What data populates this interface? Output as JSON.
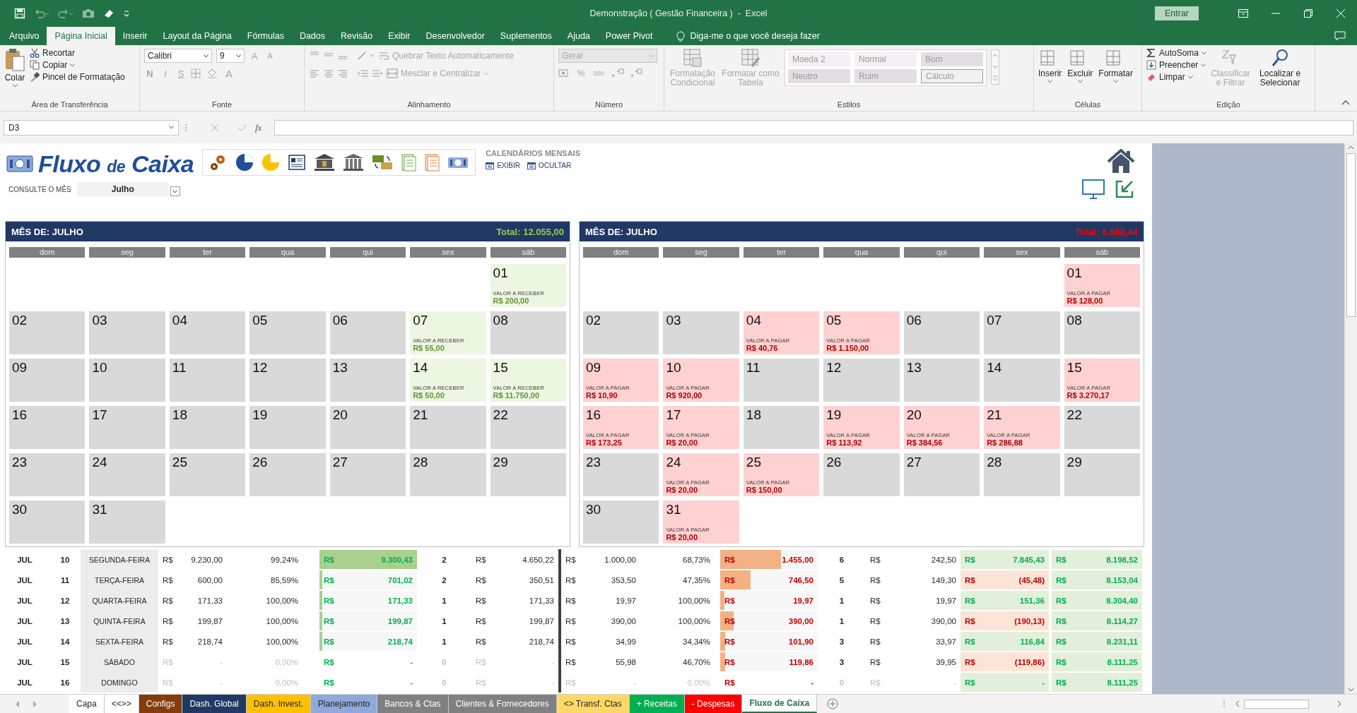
{
  "window": {
    "title": "Demonstração ( Gestão Financeira )  -  Excel",
    "sign_in": "Entrar"
  },
  "menu_tabs": [
    {
      "label": "Arquivo",
      "selected": false
    },
    {
      "label": "Página Inicial",
      "selected": true
    },
    {
      "label": "Inserir",
      "selected": false
    },
    {
      "label": "Layout da Página",
      "selected": false
    },
    {
      "label": "Fórmulas",
      "selected": false
    },
    {
      "label": "Dados",
      "selected": false
    },
    {
      "label": "Revisão",
      "selected": false
    },
    {
      "label": "Exibir",
      "selected": false
    },
    {
      "label": "Desenvolvedor",
      "selected": false
    },
    {
      "label": "Suplementos",
      "selected": false
    },
    {
      "label": "Ajuda",
      "selected": false
    },
    {
      "label": "Power Pivot",
      "selected": false
    }
  ],
  "tell_me": "Diga-me o que você deseja fazer",
  "ribbon": {
    "clipboard": {
      "title": "Área de Transferência",
      "paste": "Colar",
      "cut": "Recortar",
      "copy": "Copiar",
      "painter": "Pincel de Formatação"
    },
    "font": {
      "title": "Fonte",
      "font_name": "Calibri",
      "font_size": "9",
      "grow": "A",
      "shrink": "A",
      "format_buttons": [
        "N",
        "I",
        "S"
      ],
      "font_color": "A"
    },
    "alignment": {
      "title": "Alinhamento",
      "wrap": {
        "label": "Quebrar Texto Automaticamente",
        "disabled": true
      },
      "merge": {
        "label": "Mesclar e Centralizar",
        "disabled": true
      }
    },
    "number": {
      "title": "Número",
      "format": {
        "value": "Geral",
        "disabled": true
      },
      "percent": "%",
      "thousands": "000"
    },
    "styles": {
      "title": "Estilos",
      "conditional": {
        "label": "Formatação Condicional",
        "disabled": true
      },
      "as_table": {
        "label": "Formatar como Tabela",
        "disabled": true
      },
      "gallery": [
        {
          "label": "Moeda 2",
          "kind": "plain"
        },
        {
          "label": "Normal",
          "kind": "plain"
        },
        {
          "label": "Bom",
          "kind": "filled"
        },
        {
          "label": "Neutro",
          "kind": "filled"
        },
        {
          "label": "Ruim",
          "kind": "filled"
        },
        {
          "label": "Cálculo",
          "kind": "outlined"
        }
      ]
    },
    "cells": {
      "title": "Células",
      "items": [
        "Inserir",
        "Excluir",
        "Formatar"
      ]
    },
    "editing": {
      "title": "Edição",
      "autosum": "AutoSoma",
      "fill": "Preencher",
      "clear": "Limpar",
      "sort": {
        "label": "Classificar e Filtrar",
        "disabled": true
      },
      "find": "Localizar e Selecionar"
    }
  },
  "formula_bar": {
    "name_box": "D3",
    "fx": "fx"
  },
  "sheet": {
    "title_parts": [
      "Fluxo",
      "de",
      "Caixa"
    ],
    "calendars_label": "CALENDÁRIOS MENSAIS",
    "show": "EXIBIR",
    "hide": "OCULTAR",
    "month_prompt": "CONSULTE O MÊS",
    "month": "Julho"
  },
  "calendars": [
    {
      "title": "MÊS DE: JULHO",
      "total": "Total: 12.055,00",
      "color": "#92d050",
      "weekdays": [
        "dom",
        "seg",
        "ter",
        "qua",
        "qui",
        "sex",
        "sáb"
      ],
      "weeks": [
        [
          {
            "day": "01",
            "label": "VALOR A RECEBER",
            "amount": "R$ 200,00"
          }
        ],
        [
          {
            "day": "02"
          },
          {
            "day": "03"
          },
          {
            "day": "04"
          },
          {
            "day": "05"
          },
          {
            "day": "06"
          },
          {
            "day": "07",
            "label": "VALOR A RECEBER",
            "amount": "R$ 55,00"
          },
          {
            "day": "08"
          }
        ],
        [
          {
            "day": "09"
          },
          {
            "day": "10"
          },
          {
            "day": "11"
          },
          {
            "day": "12"
          },
          {
            "day": "13"
          },
          {
            "day": "14",
            "label": "VALOR A RECEBER",
            "amount": "R$ 50,00"
          },
          {
            "day": "15",
            "label": "VALOR A RECEBER",
            "amount": "R$ 11.750,00"
          }
        ],
        [
          {
            "day": "16"
          },
          {
            "day": "17"
          },
          {
            "day": "18"
          },
          {
            "day": "19"
          },
          {
            "day": "20"
          },
          {
            "day": "21"
          },
          {
            "day": "22"
          }
        ],
        [
          {
            "day": "23"
          },
          {
            "day": "24"
          },
          {
            "day": "25"
          },
          {
            "day": "26"
          },
          {
            "day": "27"
          },
          {
            "day": "28"
          },
          {
            "day": "29"
          }
        ],
        [
          {
            "day": "30"
          },
          {
            "day": "31"
          }
        ]
      ]
    },
    {
      "title": "MÊS DE: JULHO",
      "total": "Total: 6.688,44",
      "color": "#ff0000",
      "weekdays": [
        "dom",
        "seg",
        "ter",
        "qua",
        "qui",
        "sex",
        "sáb"
      ],
      "weeks": [
        [
          {
            "day": "01",
            "label": "VALOR A PAGAR",
            "amount": "R$ 128,00"
          }
        ],
        [
          {
            "day": "02"
          },
          {
            "day": "03"
          },
          {
            "day": "04",
            "label": "VALOR A PAGAR",
            "amount": "R$ 40,76"
          },
          {
            "day": "05",
            "label": "VALOR A PAGAR",
            "amount": "R$ 1.150,00"
          },
          {
            "day": "06"
          },
          {
            "day": "07"
          },
          {
            "day": "08"
          }
        ],
        [
          {
            "day": "09",
            "label": "VALOR A PAGAR",
            "amount": "R$ 10,90"
          },
          {
            "day": "10",
            "label": "VALOR A PAGAR",
            "amount": "R$ 920,00"
          },
          {
            "day": "11"
          },
          {
            "day": "12"
          },
          {
            "day": "13"
          },
          {
            "day": "14"
          },
          {
            "day": "15",
            "label": "VALOR A PAGAR",
            "amount": "R$ 3.270,17"
          }
        ],
        [
          {
            "day": "16",
            "label": "VALOR A PAGAR",
            "amount": "R$ 173,25"
          },
          {
            "day": "17",
            "label": "VALOR A PAGAR",
            "amount": "R$ 20,00"
          },
          {
            "day": "18"
          },
          {
            "day": "19",
            "label": "VALOR A PAGAR",
            "amount": "R$ 113,92"
          },
          {
            "day": "20",
            "label": "VALOR A PAGAR",
            "amount": "R$ 384,56"
          },
          {
            "day": "21",
            "label": "VALOR A PAGAR",
            "amount": "R$ 286,88"
          },
          {
            "day": "22"
          }
        ],
        [
          {
            "day": "23"
          },
          {
            "day": "24",
            "label": "VALOR A PAGAR",
            "amount": "R$ 20,00"
          },
          {
            "day": "25",
            "label": "VALOR A PAGAR",
            "amount": "R$ 150,00"
          },
          {
            "day": "26"
          },
          {
            "day": "27"
          },
          {
            "day": "28"
          },
          {
            "day": "29"
          }
        ],
        [
          {
            "day": "30"
          },
          {
            "day": "31",
            "label": "VALOR A PAGAR",
            "amount": "R$ 20,00"
          }
        ]
      ]
    }
  ],
  "rows": [
    {
      "month": "JUL",
      "day": "10",
      "weekday": "SEGUNDA-FEIRA",
      "in": {
        "muted": false,
        "amount": {
          "cur": "R$",
          "value": "9.230,00"
        },
        "pct": "99,24%",
        "done": {
          "cur": "R$",
          "value": "9.300,43",
          "level": 1
        },
        "count": "2",
        "avg": {
          "cur": "R$",
          "value": "4.650,22"
        }
      },
      "out": {
        "muted": false,
        "amount": {
          "cur": "R$",
          "value": "1.000,00"
        },
        "pct": "68,73%",
        "done": {
          "cur": "R$",
          "value": "1.455,00",
          "level": 0.62
        },
        "count": "6",
        "avg": {
          "cur": "R$",
          "value": "242,50"
        }
      },
      "balance": {
        "cur": "R$",
        "value": "7.845,43",
        "negative": false
      },
      "total": {
        "cur": "R$",
        "value": "8.198,52"
      }
    },
    {
      "month": "JUL",
      "day": "11",
      "weekday": "TERÇA-FEIRA",
      "in": {
        "muted": false,
        "amount": {
          "cur": "R$",
          "value": "600,00"
        },
        "pct": "85,59%",
        "done": {
          "cur": "R$",
          "value": "701,02",
          "level": 0.03
        },
        "count": "2",
        "avg": {
          "cur": "R$",
          "value": "350,51"
        }
      },
      "out": {
        "muted": false,
        "amount": {
          "cur": "R$",
          "value": "353,50"
        },
        "pct": "47,35%",
        "done": {
          "cur": "R$",
          "value": "746,50",
          "level": 0.31
        },
        "count": "5",
        "avg": {
          "cur": "R$",
          "value": "149,30"
        }
      },
      "balance": {
        "cur": "R$",
        "value": "(45,48)",
        "negative": true
      },
      "total": {
        "cur": "R$",
        "value": "8.153,04"
      }
    },
    {
      "month": "JUL",
      "day": "12",
      "weekday": "QUARTA-FEIRA",
      "in": {
        "muted": false,
        "amount": {
          "cur": "R$",
          "value": "171,33"
        },
        "pct": "100,00%",
        "done": {
          "cur": "R$",
          "value": "171,33",
          "level": 0.03
        },
        "count": "1",
        "avg": {
          "cur": "R$",
          "value": "171,33"
        }
      },
      "out": {
        "muted": false,
        "amount": {
          "cur": "R$",
          "value": "19,97"
        },
        "pct": "100,00%",
        "done": {
          "cur": "R$",
          "value": "19,97",
          "level": 0.04
        },
        "count": "1",
        "avg": {
          "cur": "R$",
          "value": "19,97"
        }
      },
      "balance": {
        "cur": "R$",
        "value": "151,36",
        "negative": false
      },
      "total": {
        "cur": "R$",
        "value": "8.304,40"
      }
    },
    {
      "month": "JUL",
      "day": "13",
      "weekday": "QUINTA-FEIRA",
      "in": {
        "muted": false,
        "amount": {
          "cur": "R$",
          "value": "199,87"
        },
        "pct": "100,00%",
        "done": {
          "cur": "R$",
          "value": "199,87",
          "level": 0.03
        },
        "count": "1",
        "avg": {
          "cur": "R$",
          "value": "199,87"
        }
      },
      "out": {
        "muted": false,
        "amount": {
          "cur": "R$",
          "value": "390,00"
        },
        "pct": "100,00%",
        "done": {
          "cur": "R$",
          "value": "390,00",
          "level": 0.14
        },
        "count": "1",
        "avg": {
          "cur": "R$",
          "value": "390,00"
        }
      },
      "balance": {
        "cur": "R$",
        "value": "(190,13)",
        "negative": true
      },
      "total": {
        "cur": "R$",
        "value": "8.114,27"
      }
    },
    {
      "month": "JUL",
      "day": "14",
      "weekday": "SEXTA-FEIRA",
      "in": {
        "muted": false,
        "amount": {
          "cur": "R$",
          "value": "218,74"
        },
        "pct": "100,00%",
        "done": {
          "cur": "R$",
          "value": "218,74",
          "level": 0.03
        },
        "count": "1",
        "avg": {
          "cur": "R$",
          "value": "218,74"
        }
      },
      "out": {
        "muted": false,
        "amount": {
          "cur": "R$",
          "value": "34,99"
        },
        "pct": "34,34%",
        "done": {
          "cur": "R$",
          "value": "101,90",
          "level": 0.05
        },
        "count": "3",
        "avg": {
          "cur": "R$",
          "value": "33,97"
        }
      },
      "balance": {
        "cur": "R$",
        "value": "116,84",
        "negative": false
      },
      "total": {
        "cur": "R$",
        "value": "8.231,11"
      }
    },
    {
      "month": "JUL",
      "day": "15",
      "weekday": "SÁBADO",
      "in": {
        "muted": true,
        "amount": {
          "cur": "R$",
          "value": "-"
        },
        "pct": "0,00%",
        "done": {
          "cur": "R$",
          "value": "-"
        },
        "count": "0",
        "avg": {
          "cur": "R$",
          "value": "-"
        }
      },
      "out": {
        "muted": false,
        "amount": {
          "cur": "R$",
          "value": "55,98"
        },
        "pct": "46,70%",
        "done": {
          "cur": "R$",
          "value": "119,86",
          "level": 0.05
        },
        "count": "3",
        "avg": {
          "cur": "R$",
          "value": "39,95"
        }
      },
      "balance": {
        "cur": "R$",
        "value": "(119,86)",
        "negative": true
      },
      "total": {
        "cur": "R$",
        "value": "8.111,25"
      }
    },
    {
      "month": "JUL",
      "day": "16",
      "weekday": "DOMINGO",
      "in": {
        "muted": true,
        "amount": {
          "cur": "R$",
          "value": "-"
        },
        "pct": "0,00%",
        "done": {
          "cur": "R$",
          "value": "-"
        },
        "count": "0",
        "avg": {
          "cur": "R$",
          "value": "-"
        }
      },
      "out": {
        "muted": true,
        "amount": {
          "cur": "R$",
          "value": "-"
        },
        "pct": "0,00%",
        "done": {
          "cur": "R$",
          "value": "-"
        },
        "count": "0",
        "avg": {
          "cur": "R$",
          "value": "-"
        }
      },
      "balance": {
        "cur": "R$",
        "value": "-",
        "negative": false
      },
      "total": {
        "cur": "R$",
        "value": "8.111,25"
      }
    }
  ],
  "sheet_tabs": [
    {
      "label": "Capa",
      "color": "#ffffff",
      "selected": false
    },
    {
      "label": "<<>>",
      "color": "#ffffff",
      "selected": false
    },
    {
      "label": "Configs",
      "color": "#843c0c",
      "selected": false
    },
    {
      "label": "Dash. Global",
      "color": "#203864",
      "selected": false
    },
    {
      "label": "Dash. Invest.",
      "color": "#ffc000",
      "selected": false
    },
    {
      "label": "Planejamento",
      "color": "#8ea9db",
      "selected": false
    },
    {
      "label": "Bancos & Ctas",
      "color": "#808080",
      "selected": false
    },
    {
      "label": "Clientes & Fornecedores",
      "color": "#808080",
      "selected": false
    },
    {
      "label": "<> Transf. Ctas",
      "color": "#ffd966",
      "selected": false
    },
    {
      "label": "+ Receitas",
      "color": "#00b050",
      "selected": false
    },
    {
      "label": "- Despesas",
      "color": "#ff0000",
      "selected": false
    },
    {
      "label": "Fluxo de Caixa",
      "color": "#ffffff",
      "selected": true
    }
  ]
}
